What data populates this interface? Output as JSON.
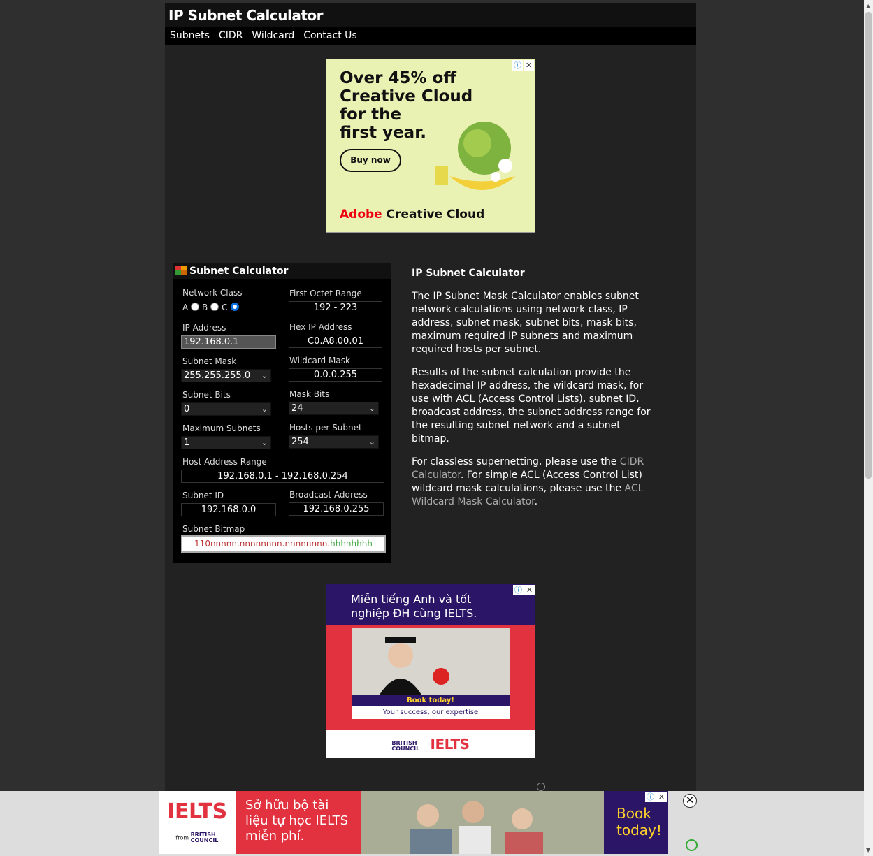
{
  "site": {
    "title": "IP Subnet Calculator"
  },
  "nav": [
    "Subnets",
    "CIDR",
    "Wildcard",
    "Contact Us"
  ],
  "ad_top": {
    "headline": [
      "Over 45% off",
      "Creative Cloud",
      "for the",
      "first year."
    ],
    "button": "Buy now",
    "brand_red": "Adobe",
    "brand": "Creative Cloud"
  },
  "calculator": {
    "title": "Subnet Calculator",
    "network_class": {
      "label": "Network Class",
      "options": [
        "A",
        "B",
        "C"
      ],
      "selected": "C"
    },
    "first_octet_range": {
      "label": "First Octet Range",
      "value": "192 - 223"
    },
    "ip_address": {
      "label": "IP Address",
      "value": "192.168.0.1"
    },
    "hex_ip_address": {
      "label": "Hex IP Address",
      "value": "C0.A8.00.01"
    },
    "subnet_mask": {
      "label": "Subnet Mask",
      "value": "255.255.255.0"
    },
    "wildcard_mask": {
      "label": "Wildcard Mask",
      "value": "0.0.0.255"
    },
    "subnet_bits": {
      "label": "Subnet Bits",
      "value": "0"
    },
    "mask_bits": {
      "label": "Mask Bits",
      "value": "24"
    },
    "maximum_subnets": {
      "label": "Maximum Subnets",
      "value": "1"
    },
    "hosts_per_subnet": {
      "label": "Hosts per Subnet",
      "value": "254"
    },
    "host_address_range": {
      "label": "Host Address Range",
      "value": "192.168.0.1 - 192.168.0.254"
    },
    "subnet_id": {
      "label": "Subnet ID",
      "value": "192.168.0.0"
    },
    "broadcast_address": {
      "label": "Broadcast Address",
      "value": "192.168.0.255"
    },
    "subnet_bitmap": {
      "label": "Subnet Bitmap",
      "network_part": "110nnnnn.nnnnnnnn.nnnnnnnn.",
      "host_part": "hhhhhhhh"
    }
  },
  "description": {
    "heading": "IP Subnet Calculator",
    "p1": "The IP Subnet Mask Calculator enables subnet network calculations using network class, IP address, subnet mask, subnet bits, mask bits, maximum required IP subnets and maximum required hosts per subnet.",
    "p2": "Results of the subnet calculation provide the hexadecimal IP address, the wildcard mask, for use with ACL (Access Control Lists), subnet ID, broadcast address, the subnet address range for the resulting subnet network and a subnet bitmap.",
    "p3_a": "For classless supernetting, please use the ",
    "p3_link1": "CIDR Calculator",
    "p3_b": ". For simple ACL (Access Control List) wildcard mask calculations, please use the ",
    "p3_link2": "ACL Wildcard Mask Calculator",
    "p3_c": "."
  },
  "ad_middle": {
    "headline_line1": "Miễn tiếng Anh và tốt",
    "headline_line2": "nghiệp ĐH cùng IELTS.",
    "book": "Book today!",
    "tagline": "Your success, our expertise",
    "brand_bc": "BRITISH COUNCIL",
    "brand_ielts": "IELTS"
  },
  "ad_bottom": {
    "logo": "IELTS",
    "from": "from",
    "brand_bc": "BRITISH COUNCIL",
    "text": "Sở hữu bộ tài liệu tự học IELTS miễn phí.",
    "book": "Book today!"
  },
  "colors": {
    "page_bg": "#2f2f2f",
    "content_bg": "#222222",
    "nav_bg": "#000000",
    "ielts_red": "#e2323f",
    "ielts_purple": "#2b1566"
  }
}
